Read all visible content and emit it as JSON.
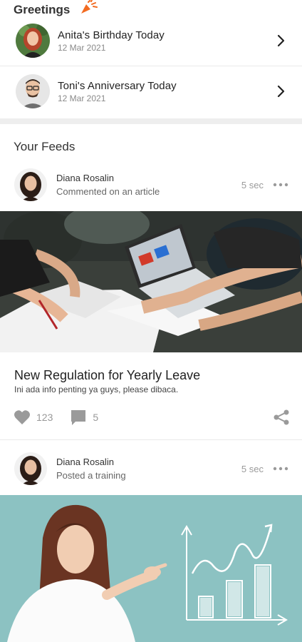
{
  "greetings": {
    "title": "Greetings",
    "items": [
      {
        "title": "Anita's Birthday Today",
        "date": "12 Mar 2021"
      },
      {
        "title": "Toni's Anniversary Today",
        "date": "12 Mar 2021"
      }
    ]
  },
  "feeds": {
    "title": "Your Feeds",
    "posts": [
      {
        "author": "Diana Rosalin",
        "action": "Commented on an article",
        "time": "5 sec",
        "title": "New Regulation for Yearly Leave",
        "subtitle": "Ini ada info penting ya guys, please dibaca.",
        "likes": "123",
        "comments": "5"
      },
      {
        "author": "Diana Rosalin",
        "action": "Posted a training",
        "time": "5 sec"
      }
    ]
  },
  "icons": {
    "party": "party-popper-icon",
    "chevron": "chevron-right-icon",
    "more": "more-horizontal-icon",
    "like": "heart-icon",
    "comment": "comment-icon",
    "share": "share-icon"
  },
  "colors": {
    "party": "#f26b21",
    "icon_gray": "#9a9a9a",
    "training_bg": "#8cc2c2"
  }
}
